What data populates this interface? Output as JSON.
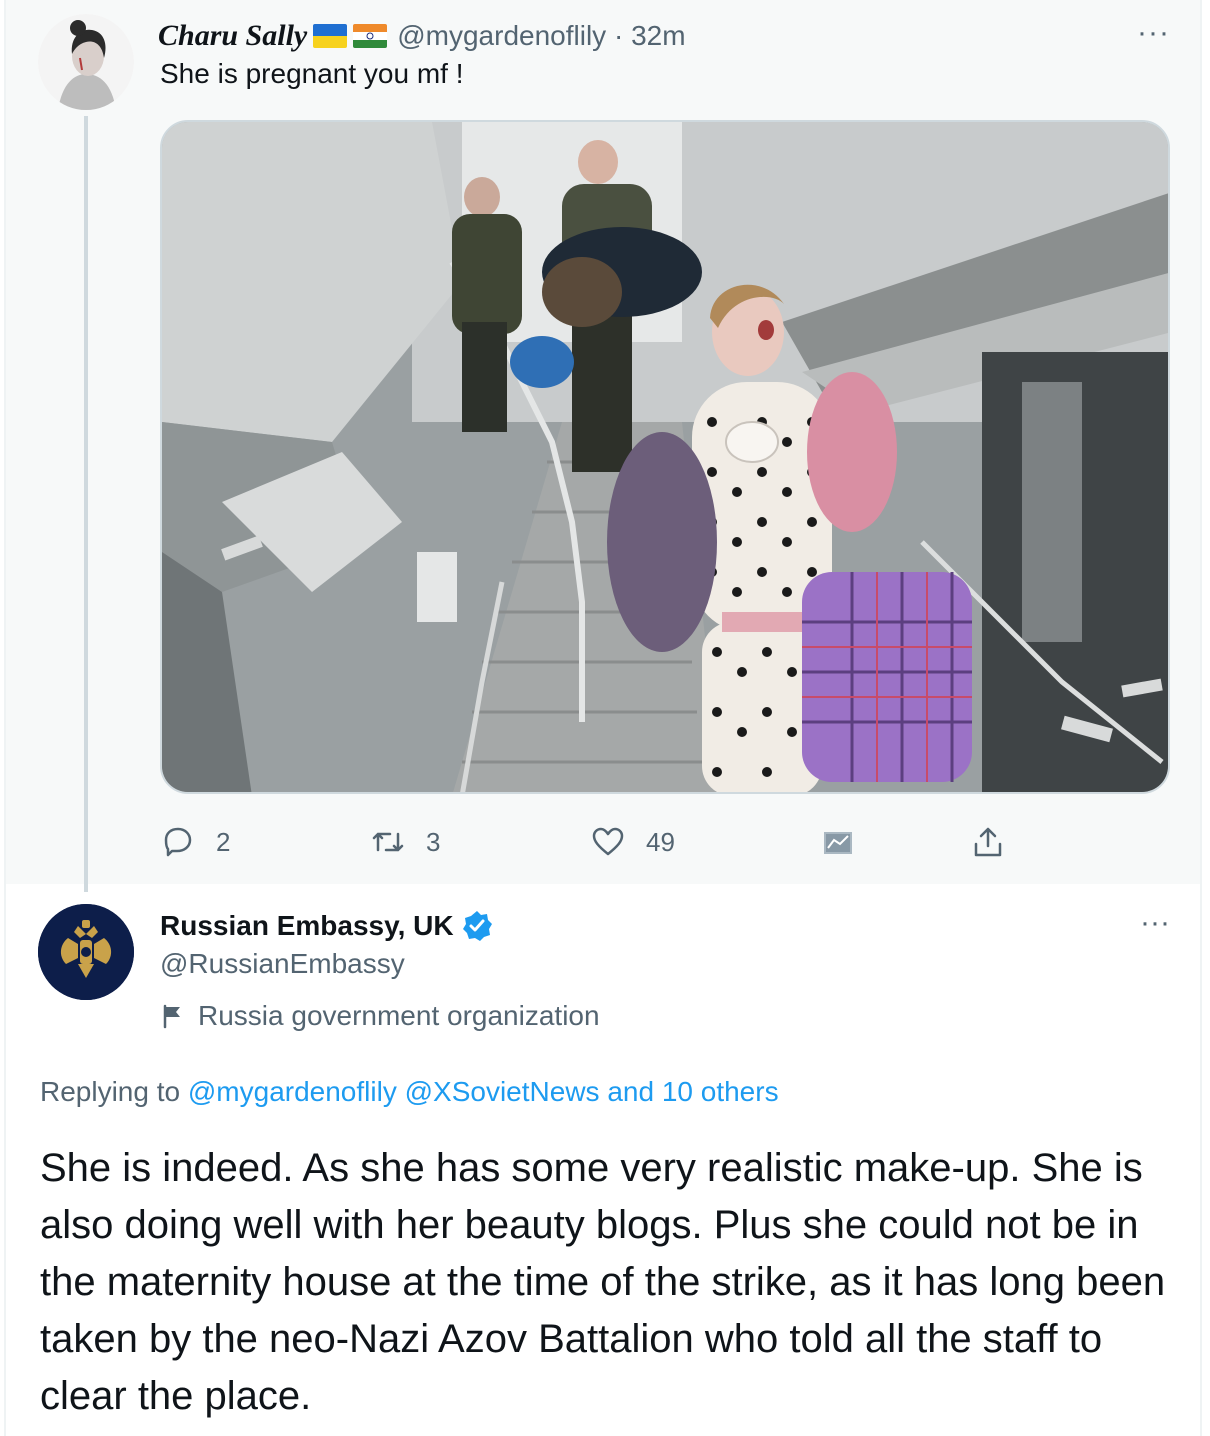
{
  "parent": {
    "name": "Charu Sally",
    "flags": [
      "ukraine-flag",
      "india-flag"
    ],
    "handle": "@mygardenoflily",
    "separator": "·",
    "time": "32m",
    "text": "She is pregnant you mf !",
    "more_label": "···",
    "photo_icon": "war-photo-image",
    "actions": {
      "replies": "2",
      "retweets": "3",
      "likes": "49"
    }
  },
  "reply": {
    "name": "Russian Embassy, UK",
    "handle": "@RussianEmbassy",
    "more_label": "···",
    "gov_label": "Russia government organization",
    "replying_prefix": "Replying to",
    "replying_users": [
      "@mygardenoflily",
      "@XSovietNews"
    ],
    "replying_others": "and 10 others",
    "text": "She is indeed. As she has some very realistic make-up. She is also doing well with her beauty blogs. Plus she could not be in the maternity house at the time of the strike, as it has long been taken by the neo-Nazi Azov Battalion who told all the staff to clear the place."
  },
  "colors": {
    "accent": "#1d9bf0",
    "muted": "#536471",
    "text": "#0f1419",
    "parent_bg": "#f7f9f9"
  }
}
